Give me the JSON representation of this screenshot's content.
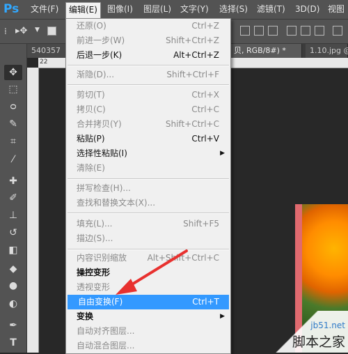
{
  "app": {
    "logo": "Ps"
  },
  "menubar": {
    "items": [
      {
        "label": "文件(F)"
      },
      {
        "label": "编辑(E)"
      },
      {
        "label": "图像(I)"
      },
      {
        "label": "图层(L)"
      },
      {
        "label": "文字(Y)"
      },
      {
        "label": "选择(S)"
      },
      {
        "label": "滤镜(T)"
      },
      {
        "label": "3D(D)"
      },
      {
        "label": "视图"
      }
    ]
  },
  "doc": {
    "tabs": [
      {
        "label": "540357"
      },
      {
        "label": "贝, RGB/8#) *"
      },
      {
        "label": "1.10.jpg @"
      }
    ],
    "ruler_label": "22"
  },
  "edit_menu": {
    "items": [
      {
        "label": "还原(O)",
        "shortcut": "Ctrl+Z"
      },
      {
        "label": "前进一步(W)",
        "shortcut": "Shift+Ctrl+Z"
      },
      {
        "label": "后退一步(K)",
        "shortcut": "Alt+Ctrl+Z"
      },
      {
        "label": "渐隐(D)...",
        "shortcut": "Shift+Ctrl+F"
      },
      {
        "label": "剪切(T)",
        "shortcut": "Ctrl+X"
      },
      {
        "label": "拷贝(C)",
        "shortcut": "Ctrl+C"
      },
      {
        "label": "合并拷贝(Y)",
        "shortcut": "Shift+Ctrl+C"
      },
      {
        "label": "粘贴(P)",
        "shortcut": "Ctrl+V"
      },
      {
        "label": "选择性粘贴(I)",
        "shortcut": ""
      },
      {
        "label": "清除(E)",
        "shortcut": ""
      },
      {
        "label": "拼写检查(H)...",
        "shortcut": ""
      },
      {
        "label": "查找和替换文本(X)...",
        "shortcut": ""
      },
      {
        "label": "填充(L)...",
        "shortcut": "Shift+F5"
      },
      {
        "label": "描边(S)...",
        "shortcut": ""
      },
      {
        "label": "内容识别缩放",
        "shortcut": "Alt+Shift+Ctrl+C"
      },
      {
        "label": "操控变形",
        "shortcut": ""
      },
      {
        "label": "透视变形",
        "shortcut": ""
      },
      {
        "label": "自由变换(F)",
        "shortcut": "Ctrl+T"
      },
      {
        "label": "变换",
        "shortcut": ""
      },
      {
        "label": "自动对齐图层...",
        "shortcut": ""
      },
      {
        "label": "自动混合图层...",
        "shortcut": ""
      }
    ]
  },
  "watermark": {
    "site": "jb51.net",
    "name": "脚本之家"
  },
  "colors": {
    "highlight": "#3399ff",
    "arrow": "#e8312f",
    "ps_blue": "#31a8ff"
  }
}
